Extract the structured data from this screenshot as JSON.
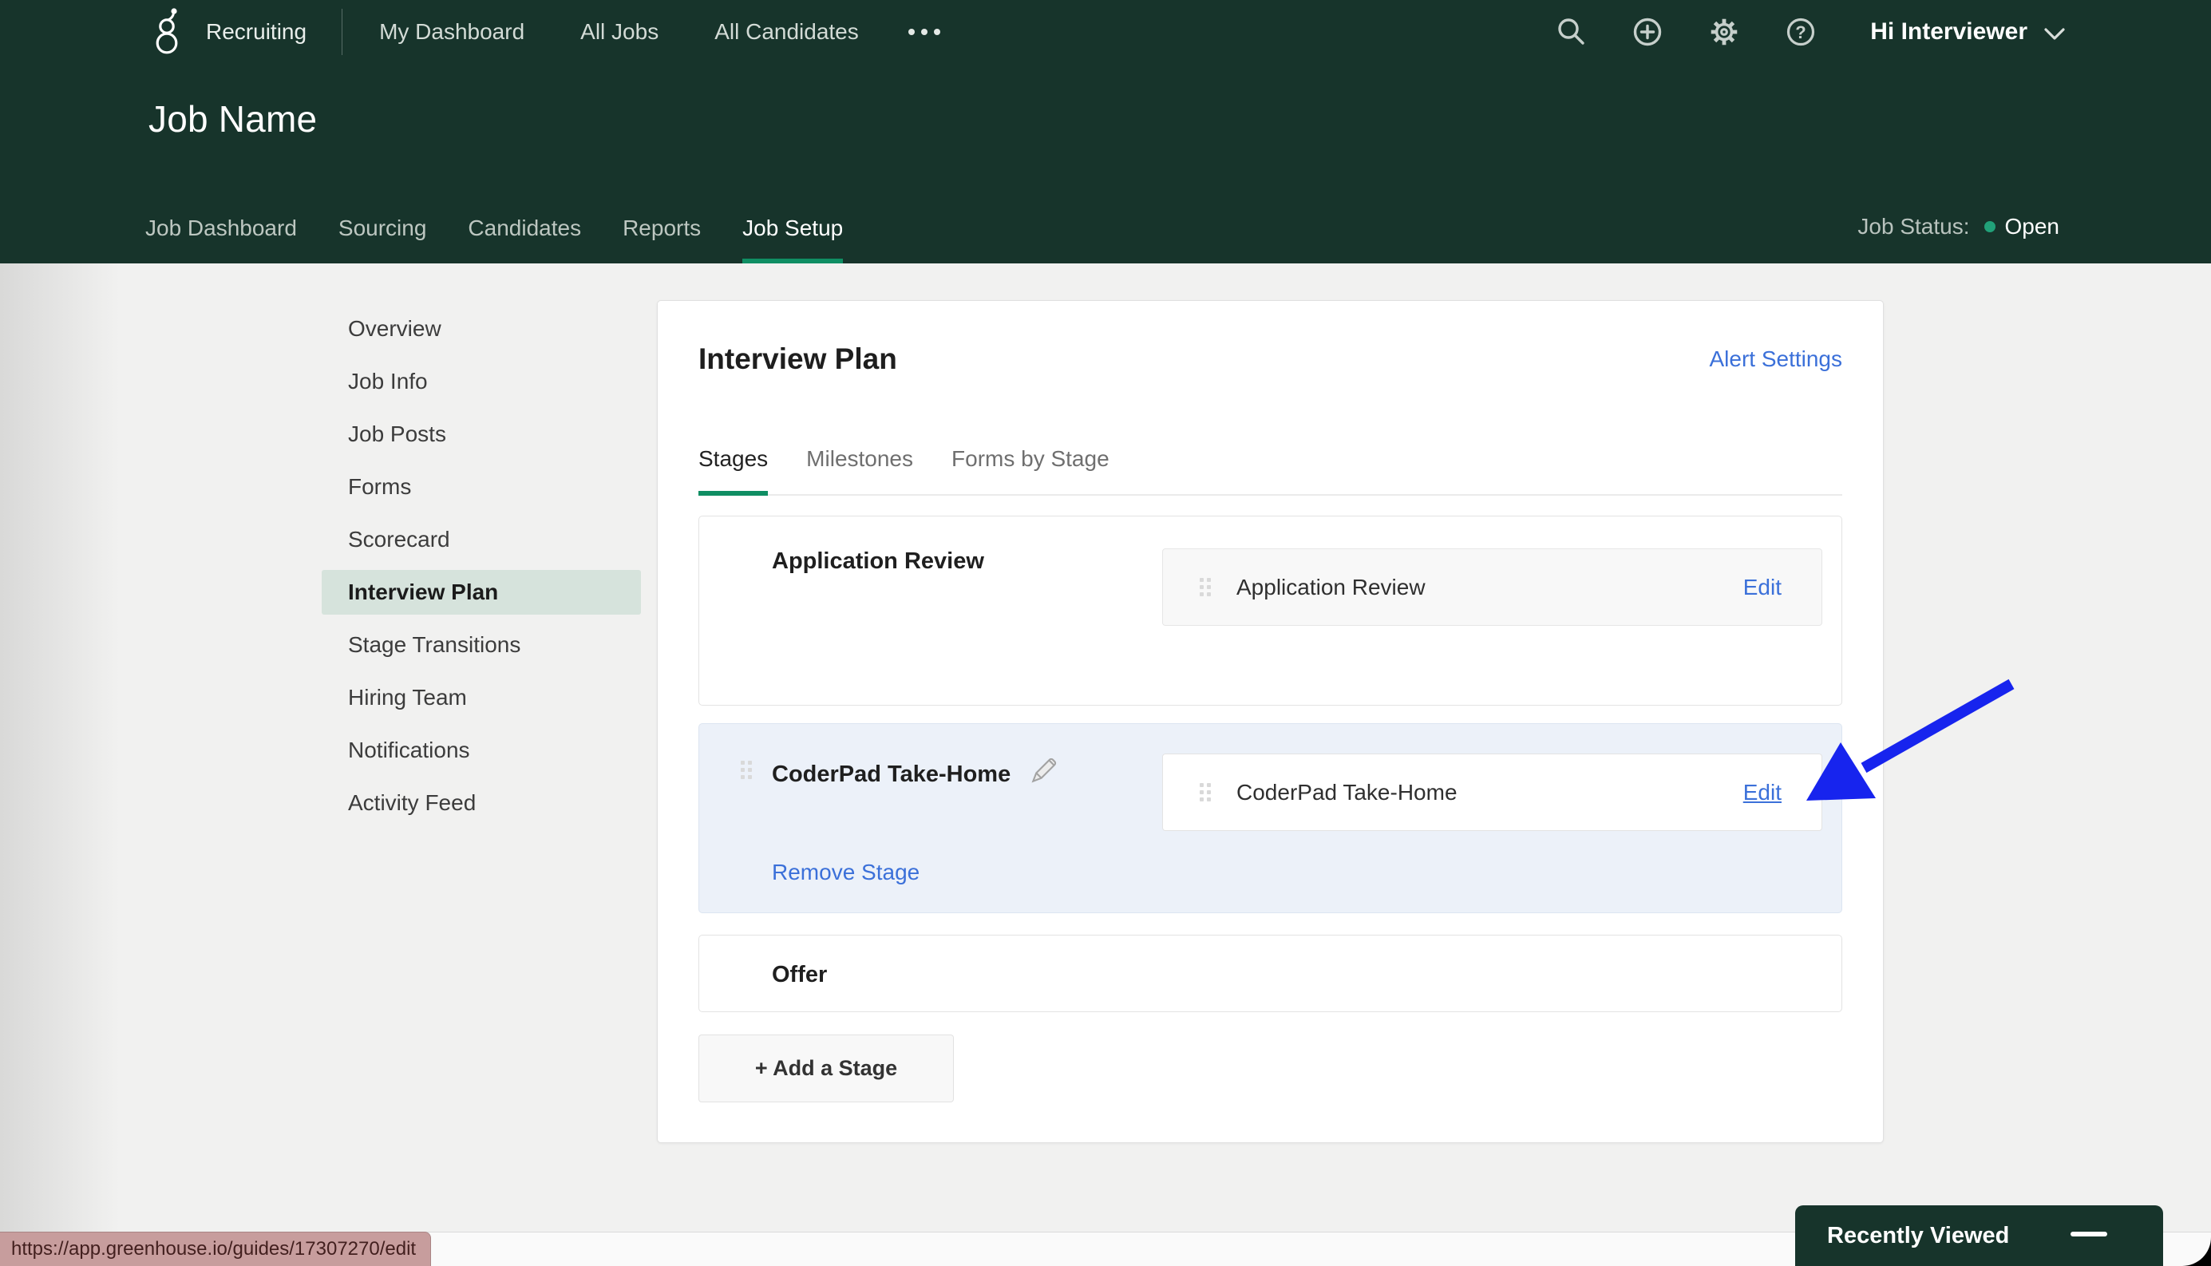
{
  "topnav": {
    "product": "Recruiting",
    "items": [
      {
        "label": "My Dashboard"
      },
      {
        "label": "All Jobs"
      },
      {
        "label": "All Candidates"
      }
    ],
    "user": "Hi Interviewer"
  },
  "job_header": {
    "title": "Job Name",
    "tabs": [
      {
        "label": "Job Dashboard"
      },
      {
        "label": "Sourcing"
      },
      {
        "label": "Candidates"
      },
      {
        "label": "Reports"
      },
      {
        "label": "Job Setup"
      }
    ],
    "active_tab": "Job Setup",
    "status_label": "Job Status:",
    "status_value": "Open"
  },
  "sidebar": {
    "items": [
      {
        "label": "Overview"
      },
      {
        "label": "Job Info"
      },
      {
        "label": "Job Posts"
      },
      {
        "label": "Forms"
      },
      {
        "label": "Scorecard"
      },
      {
        "label": "Interview Plan"
      },
      {
        "label": "Stage Transitions"
      },
      {
        "label": "Hiring Team"
      },
      {
        "label": "Notifications"
      },
      {
        "label": "Activity Feed"
      }
    ],
    "active_item": "Interview Plan"
  },
  "main": {
    "title": "Interview Plan",
    "alert_settings": "Alert Settings",
    "tabs": [
      {
        "label": "Stages"
      },
      {
        "label": "Milestones"
      },
      {
        "label": "Forms by Stage"
      }
    ],
    "active_tab": "Stages",
    "stages": [
      {
        "name": "Application Review",
        "interviews": [
          {
            "name": "Application Review",
            "edit_label": "Edit"
          }
        ]
      },
      {
        "name": "CoderPad Take-Home",
        "interviews": [
          {
            "name": "CoderPad Take-Home",
            "edit_label": "Edit"
          }
        ],
        "remove_label": "Remove Stage"
      },
      {
        "name": "Offer",
        "interviews": []
      }
    ],
    "add_stage_label": "+ Add a Stage"
  },
  "status_bar": {
    "link_preview": "https://app.greenhouse.io/guides/17307270/edit"
  },
  "recently_viewed": {
    "title": "Recently Viewed"
  },
  "colors": {
    "header_green": "#17342B",
    "accent_green": "#0F8E63",
    "status_dot_green": "#21A179",
    "link_blue": "#3B70D9",
    "arrow_blue": "#1724EE",
    "sidebar_active_bg": "#D6E3DC",
    "stage_highlight_bg": "#ECF1F9",
    "tooltip_bg": "#C79D9D"
  }
}
